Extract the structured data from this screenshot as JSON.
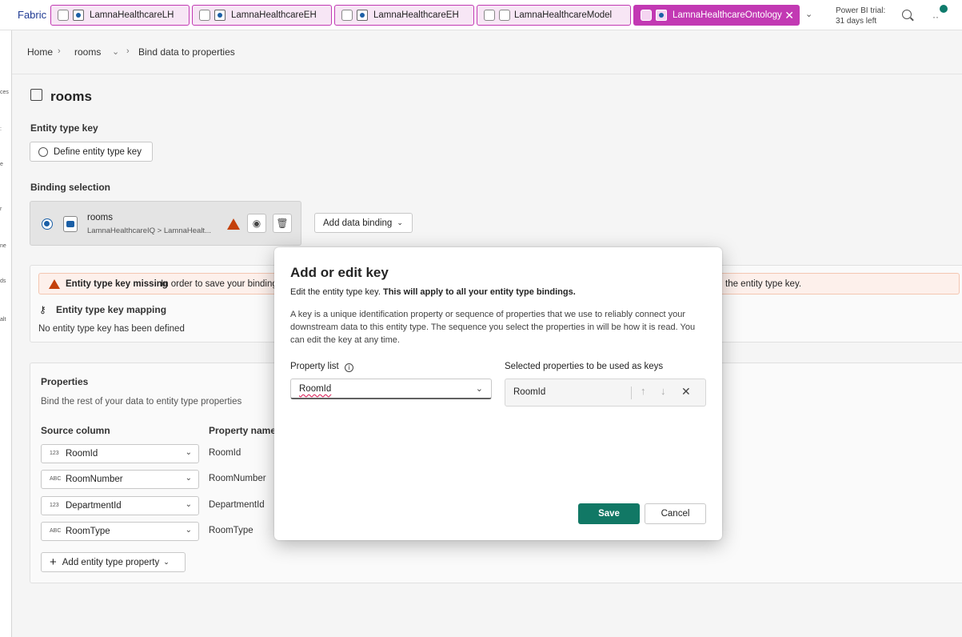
{
  "topbar": {
    "brand": "Fabric",
    "tabs": [
      {
        "label": "LamnaHealthcareLH"
      },
      {
        "label": "LamnaHealthcareEH"
      },
      {
        "label": "LamnaHealthcareEH"
      },
      {
        "label": "LamnaHealthcareModel"
      },
      {
        "label": "LamnaHealthcareOntology"
      }
    ],
    "trial_line1": "Power BI trial:",
    "trial_line2": "31 days left",
    "accent_color": "#c239b3"
  },
  "breadcrumb": {
    "home": "Home",
    "entity": "rooms",
    "current": "Bind data to properties"
  },
  "page": {
    "title": "rooms",
    "entity_key_label": "Entity type key",
    "define_key_button": "Define entity type key",
    "binding_selection_label": "Binding selection",
    "binding": {
      "name": "rooms",
      "path": "LamnaHealthcareIQ > LamnaHealt..."
    },
    "add_binding_button": "Add data binding",
    "alert": {
      "title": "Entity type key missing",
      "text_start": "In order to save your binding",
      "text_end": "the entity type key.",
      "color": "#c4410c"
    },
    "key_mapping_label": "Entity type key mapping",
    "no_key_text": "No entity type key has been defined",
    "properties": {
      "title": "Properties",
      "subtitle": "Bind the rest of your data to entity type properties",
      "source_column_header": "Source column",
      "property_name_header": "Property name",
      "rows": [
        {
          "type": "123",
          "source": "RoomId",
          "property": "RoomId"
        },
        {
          "type": "ABC",
          "source": "RoomNumber",
          "property": "RoomNumber"
        },
        {
          "type": "123",
          "source": "DepartmentId",
          "property": "DepartmentId"
        },
        {
          "type": "ABC",
          "source": "RoomType",
          "property": "RoomType"
        }
      ],
      "add_property_button": "Add entity type property"
    }
  },
  "dialog": {
    "title": "Add or edit key",
    "subtitle_start": "Edit the entity type key.",
    "subtitle_bold": "This will apply to all your entity type bindings.",
    "description": "A key is a unique identification property or sequence of properties that we use to reliably connect your downstream data to this entity type. The sequence you select the properties in will be how it is read. You can edit the key at any time.",
    "property_list_label": "Property list",
    "property_list_value": "RoomId",
    "selected_label": "Selected properties to be used as keys",
    "selected_value": "RoomId",
    "save_button": "Save",
    "cancel_button": "Cancel",
    "primary_color": "#117865"
  }
}
